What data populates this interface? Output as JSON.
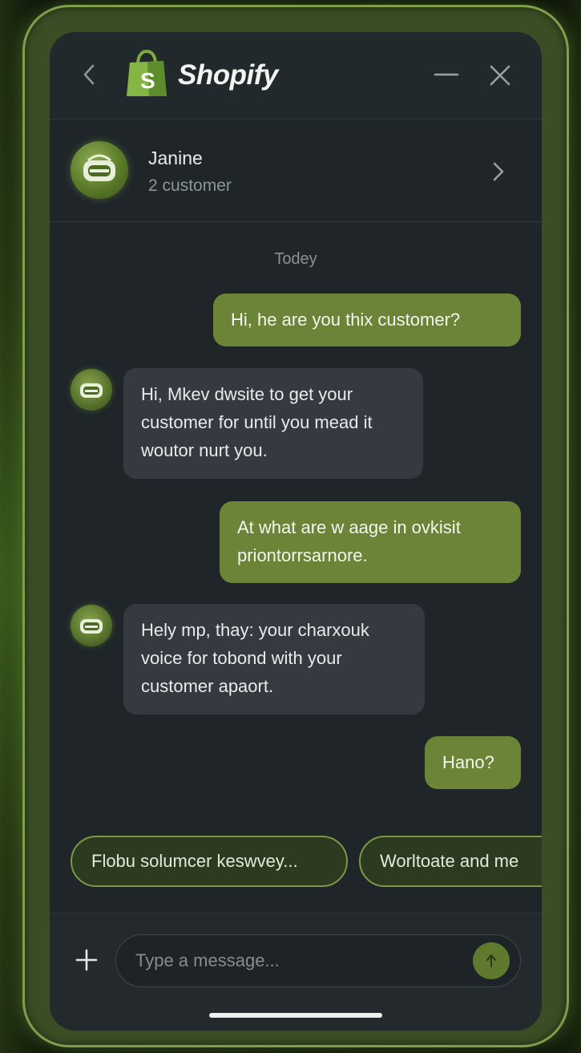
{
  "header": {
    "brand": "Shopify",
    "back_icon": "chevron-left-icon",
    "minimize_icon": "minus-icon",
    "close_icon": "close-icon",
    "logo_icon": "shopping-bag-logo"
  },
  "contact": {
    "name": "Janine",
    "subtitle": "2 customer",
    "chevron_icon": "chevron-right-icon"
  },
  "conversation": {
    "date_label": "Todey",
    "messages": [
      {
        "from": "me",
        "text": "Hi, he are you thix customer?"
      },
      {
        "from": "bot",
        "text": "Hi, Mkev dwsite to get your customer for until you mead it woutor nurt you."
      },
      {
        "from": "me",
        "text": "At what are w aage in ovkisit priontorrsarnore."
      },
      {
        "from": "bot",
        "text": "Hely mp, thay: your charxouk voice for tobond with your customer apaort."
      },
      {
        "from": "me",
        "text": "Hano?"
      }
    ]
  },
  "quick_replies": [
    "Flobu solumcer keswvey...",
    "Worltoate and me"
  ],
  "composer": {
    "placeholder": "Type a message...",
    "add_icon": "plus-icon",
    "send_icon": "send-arrow-icon"
  },
  "colors": {
    "accent": "#6b8437",
    "outgoing_bubble": "#6b8437",
    "incoming_bubble": "#343a3f",
    "screen_bg": "#1f2529"
  }
}
